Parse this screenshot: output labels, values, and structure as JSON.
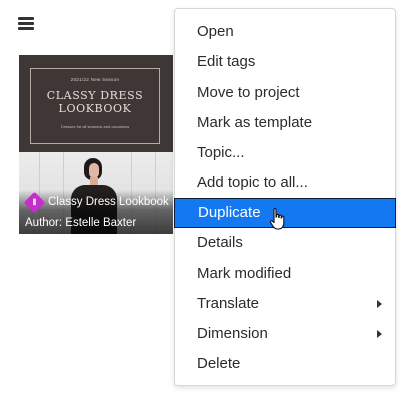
{
  "toolbar": {
    "menu_icon": "hamburger-menu-icon"
  },
  "card": {
    "title": "Classy Dress Lookbook",
    "author": "Author: Estelle Baxter",
    "badge_icon": "template-badge-icon",
    "badge_color": "#c22fc9",
    "cover": {
      "season": "2021/22 New Season",
      "title": "CLASSY DRESS\nLOOKBOOK",
      "subtitle": "Dresses for all seasons and occasions"
    }
  },
  "context_menu": {
    "items": [
      {
        "label": "Open"
      },
      {
        "label": "Edit tags"
      },
      {
        "label": "Move to project"
      },
      {
        "label": "Mark as template"
      },
      {
        "label": "Topic..."
      },
      {
        "label": "Add topic to all..."
      },
      {
        "label": "Duplicate",
        "highlighted": true
      },
      {
        "label": "Details"
      },
      {
        "label": "Mark modified"
      },
      {
        "label": "Translate",
        "has_submenu": true
      },
      {
        "label": "Dimension",
        "has_submenu": true
      },
      {
        "label": "Delete"
      }
    ],
    "highlight_color": "#1378f2"
  },
  "cursor": {
    "icon": "hand-pointer-cursor-icon"
  }
}
